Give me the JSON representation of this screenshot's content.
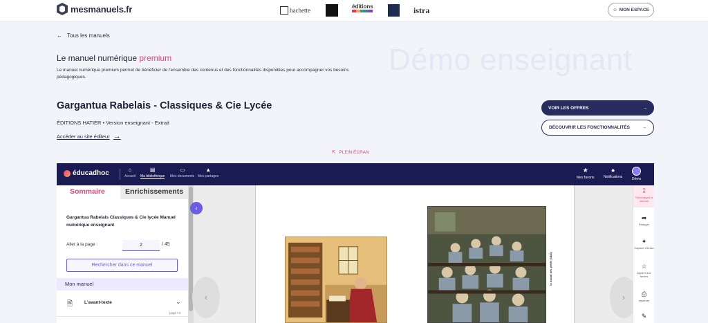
{
  "header": {
    "brand": "mesmanuels.fr",
    "partners": [
      "hachette",
      "éditions",
      "istra"
    ],
    "account_label": "MON ESPACE"
  },
  "back_link": "Tous les manuels",
  "watermark": "Démo enseignant",
  "premium": {
    "title_prefix": "Le manuel numérique",
    "title_accent": "premium",
    "description": "Le manuel numérique premium permet de bénéficier de l'ensemble des contenus et des fonctionnalités disponibles pour accompagner vos besoins pédagogiques."
  },
  "book": {
    "title": "Gargantua Rabelais - Classiques & Cie Lycée",
    "subtitle": "ÉDITIONS HATIER • Version enseignant - Extrait",
    "editor_link": "Accéder au site éditeur"
  },
  "actions": {
    "offers": "VOIR LES OFFRES",
    "features": "DÉCOUVRIR LES FONCTIONNALITÉS",
    "fullscreen": "PLEIN ÉCRAN"
  },
  "viewer": {
    "brand": "éducadhoc",
    "nav": [
      {
        "label": "Accueil",
        "icon": "home-icon"
      },
      {
        "label": "Ma bibliothèque",
        "icon": "book-icon"
      },
      {
        "label": "Mes documents",
        "icon": "documents-icon"
      },
      {
        "label": "Mes partages",
        "icon": "graduation-cap-icon"
      }
    ],
    "right": [
      {
        "label": "Mes favoris",
        "icon": "star-icon"
      },
      {
        "label": "Notifications",
        "icon": "bell-icon"
      },
      {
        "label": "Démo",
        "icon": "avatar"
      }
    ],
    "sidebar": {
      "tab_summary": "Sommaire",
      "tab_enrich": "Enrichissements",
      "book_title": "Gargantua Rabelais Classiques & Cie lycée Manuel numérique enseignant",
      "goto_label": "Aller à la page :",
      "page_value": "2",
      "page_total": "/ 45",
      "search_button": "Rechercher dans ce manuel",
      "section": "Mon manuel",
      "item_label": "L'avant-texte",
      "item_page": "page I-II"
    },
    "caption": "la travail des petits (1883)",
    "tools": [
      {
        "label": "Télécharger le manuel",
        "icon": "download-icon"
      },
      {
        "label": "Partager",
        "icon": "share-icon"
      },
      {
        "label": "Capture d'écran",
        "icon": "capture-icon"
      },
      {
        "label": "Ajouter aux favoris",
        "icon": "star-outline-icon"
      },
      {
        "label": "Imprimer",
        "icon": "print-icon"
      },
      {
        "label": "",
        "icon": "pen-icon"
      }
    ],
    "accent": "#6b5ce7",
    "navy": "#1a1b52",
    "pink": "#e8437a"
  }
}
